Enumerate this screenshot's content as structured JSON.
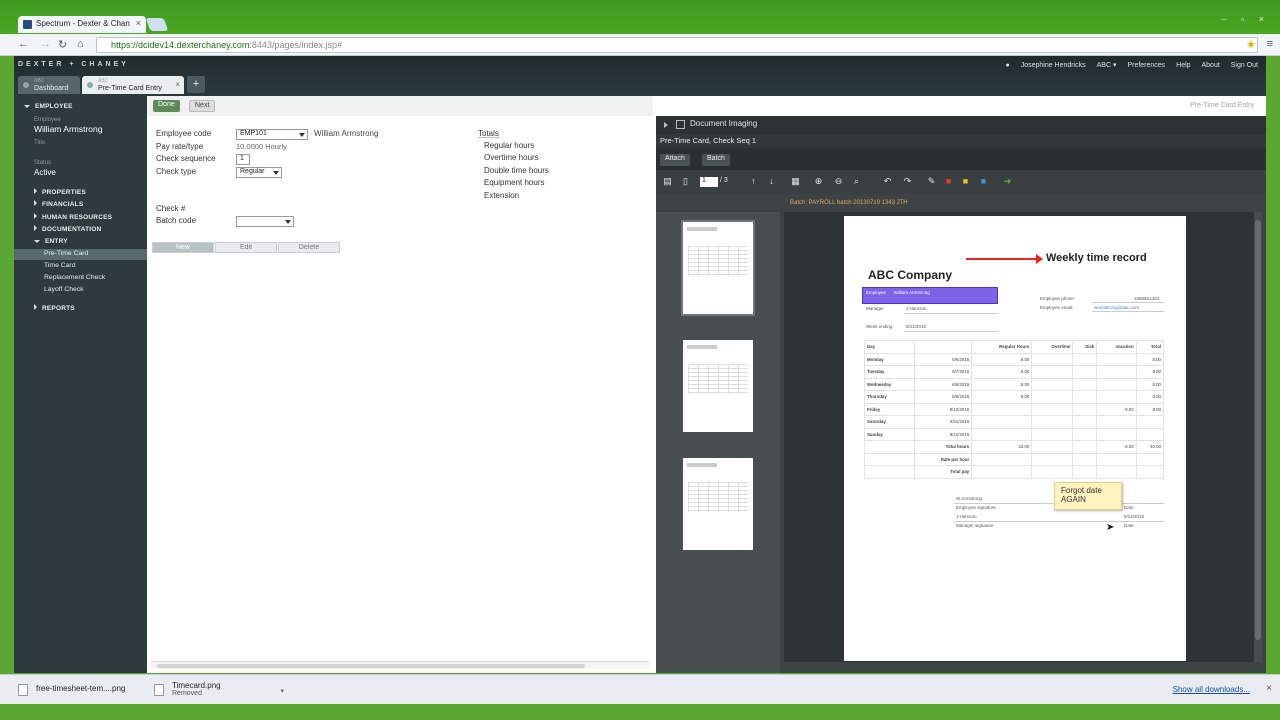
{
  "browser": {
    "tab_title": "Spectrum - Dexter & Chan",
    "url_main": "https://dcidev14.dexterchaney.com",
    "url_rest": ":8443/pages/index.jsp#",
    "window_buttons": "–  ▫  ×"
  },
  "app": {
    "brand": "DEXTER + CHANEY",
    "user": "Josephine Hendricks",
    "links": [
      "ABC ▾",
      "Preferences",
      "Help",
      "About",
      "Sign Out"
    ],
    "tabs": [
      {
        "sub": "ABC",
        "label": "Dashboard"
      },
      {
        "sub": "ABC",
        "label": "Pre-Time Card Entry"
      }
    ],
    "page_title": "Pre-Time Card Entry"
  },
  "sidebar": {
    "section": "EMPLOYEE",
    "employee_label": "Employee",
    "employee_name": "William Armstrong",
    "title_label": "Title",
    "status_label": "Status",
    "status": "Active",
    "groups": [
      "PROPERTIES",
      "FINANCIALS",
      "HUMAN RESOURCES",
      "DOCUMENTATION",
      "ENTRY"
    ],
    "entry_items": [
      "Pre-Time Card",
      "Time Card",
      "Replacement Check",
      "Layoff Check"
    ],
    "reports": "REPORTS"
  },
  "toolbar": {
    "done": "Done",
    "next": "Next"
  },
  "form": {
    "employee_code_label": "Employee code",
    "employee_code": "EMP101",
    "employee_name": "William Armstrong",
    "pay_rate_label": "Pay rate/type",
    "pay_rate": "10.0000 Hourly",
    "check_seq_label": "Check sequence",
    "check_seq": "1",
    "check_type_label": "Check type",
    "check_type": "Regular",
    "check_no_label": "Check #",
    "batch_code_label": "Batch code",
    "batch_code": "",
    "totals_label": "Totals",
    "totals": [
      "Regular hours",
      "Overtime hours",
      "Double time hours",
      "Equipment hours",
      "Extension"
    ],
    "actions": [
      "New",
      "Edit",
      "Delete"
    ]
  },
  "docimg": {
    "title": "Document Imaging",
    "subtitle": "Pre-Time Card, Check Seq 1",
    "tabs": [
      "Attach",
      "Batch"
    ],
    "page": "1",
    "page_of": "/ 3",
    "batch_text": "Batch: PAYROLL batch 20130719 1343 JTH"
  },
  "scan": {
    "company": "ABC Company",
    "title": "Weekly time record",
    "employee_label": "Employee",
    "employee_value": "William Armstrong",
    "manager_label": "Manager",
    "manager_value": "J.Harrison",
    "week_label": "Week ending",
    "week_value": "8/12/2016",
    "phone_label": "Employee phone:",
    "phone_value": "2065551424",
    "email_label": "Employee email:",
    "email_value": "warmstrong@abc.com",
    "columns": [
      "Day",
      "",
      "Regular Hours",
      "Overtime",
      "Sick",
      "Vacation",
      "Total"
    ],
    "rows": [
      [
        "Monday",
        "8/6/2016",
        "8.00",
        "",
        "",
        "",
        "8.00"
      ],
      [
        "Tuesday",
        "8/7/2016",
        "8.00",
        "",
        "",
        "",
        "8.00"
      ],
      [
        "Wednesday",
        "8/8/2016",
        "8.00",
        "",
        "",
        "",
        "8.00"
      ],
      [
        "Thursday",
        "8/9/2016",
        "8.00",
        "",
        "",
        "",
        "8.00"
      ],
      [
        "Friday",
        "8/10/2016",
        "",
        "",
        "",
        "8.00",
        "8.00"
      ],
      [
        "Saturday",
        "8/11/2016",
        "",
        "",
        "",
        "",
        ""
      ],
      [
        "Sunday",
        "8/12/2016",
        "",
        "",
        "",
        "",
        ""
      ],
      [
        "",
        "Total hours",
        "32.00",
        "",
        "",
        "8.00",
        "40.00"
      ],
      [
        "",
        "Rate per hour",
        "",
        "",
        "",
        "",
        ""
      ],
      [
        "",
        "Total pay",
        "",
        "",
        "",
        "",
        ""
      ]
    ],
    "sig_employee": "W.Armstrong",
    "sig_employee_label": "Employee signature",
    "sig_manager": "J.Harrison",
    "sig_manager_label": "Manager signature",
    "date_label": "Date",
    "sig_date": "8/12/2016",
    "note": "Forgot date AGAIN"
  },
  "downloads": {
    "items": [
      {
        "name": "free-timesheet-tem....png",
        "sub": ""
      },
      {
        "name": "Timecard.png",
        "sub": "Removed"
      }
    ],
    "show_all": "Show all downloads..."
  }
}
